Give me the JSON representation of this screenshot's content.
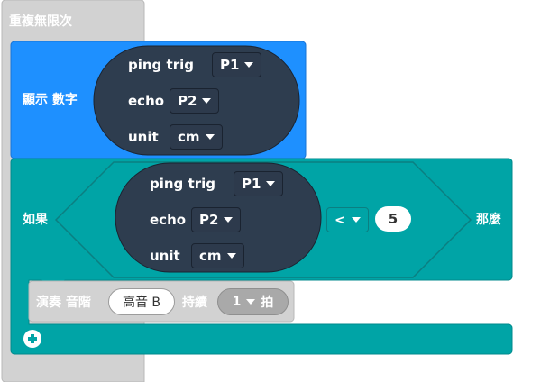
{
  "forever": {
    "label": "重複無限次"
  },
  "show_number": {
    "label": "顯示 數字"
  },
  "ping_show": {
    "trig_label": "ping trig",
    "trig_pin": "P1",
    "echo_label": "echo",
    "echo_pin": "P2",
    "unit_label": "unit",
    "unit_value": "cm"
  },
  "if_block": {
    "if_label": "如果",
    "then_label": "那麼",
    "operator": "<",
    "compare_value": "5"
  },
  "ping_cond": {
    "trig_label": "ping trig",
    "trig_pin": "P1",
    "echo_label": "echo",
    "echo_pin": "P2",
    "unit_label": "unit",
    "unit_value": "cm"
  },
  "play_tone": {
    "label_play": "演奏 音階",
    "note": "高音 B",
    "label_duration": "持續",
    "beats": "1",
    "beat_unit": "拍"
  },
  "colors": {
    "forever": "#d2d2d2",
    "basic": "#1e90ff",
    "logic": "#00a4a6",
    "sonar": "#2e3d4f",
    "music": "#d2d2d2"
  },
  "icons": {
    "add_else": "plus-circle-icon",
    "dropdown": "caret-down-icon"
  }
}
